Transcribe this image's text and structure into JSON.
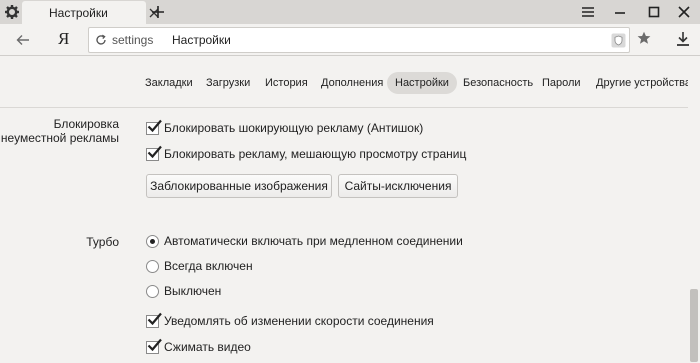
{
  "window": {
    "tab_title": "Настройки"
  },
  "toolbar": {
    "logo": "Я",
    "address_host": "settings",
    "address_title": "Настройки"
  },
  "nav": {
    "items": [
      "Закладки",
      "Загрузки",
      "История",
      "Дополнения",
      "Настройки",
      "Безопасность",
      "Пароли",
      "Другие устройства"
    ],
    "active": "Настройки"
  },
  "ads": {
    "label_line1": "Блокировка",
    "label_line2": "неуместной рекламы",
    "options": [
      {
        "label": "Блокировать шокирующую рекламу (Антишок)",
        "checked": true
      },
      {
        "label": "Блокировать рекламу, мешающую просмотру страниц",
        "checked": true
      }
    ],
    "buttons": {
      "blocked_images": "Заблокированные изображения",
      "exceptions": "Сайты-исключения"
    }
  },
  "turbo": {
    "label": "Турбо",
    "radios": [
      {
        "label": "Автоматически включать при медленном соединении",
        "selected": true
      },
      {
        "label": "Всегда включен",
        "selected": false
      },
      {
        "label": "Выключен",
        "selected": false
      }
    ],
    "checkboxes": [
      {
        "label": "Уведомлять об изменении скорости соединения",
        "checked": true
      },
      {
        "label": "Сжимать видео",
        "checked": true
      }
    ]
  },
  "icons": {
    "settings": "gear-icon",
    "close_tab": "close-icon",
    "new_tab": "plus-icon",
    "menu": "hamburger-icon",
    "minimize": "minimize-icon",
    "maximize": "maximize-icon",
    "close_window": "close-icon",
    "back": "arrow-left-icon",
    "reload": "reload-icon",
    "protect": "shield-icon",
    "bookmark": "star-icon",
    "downloads": "download-icon"
  }
}
